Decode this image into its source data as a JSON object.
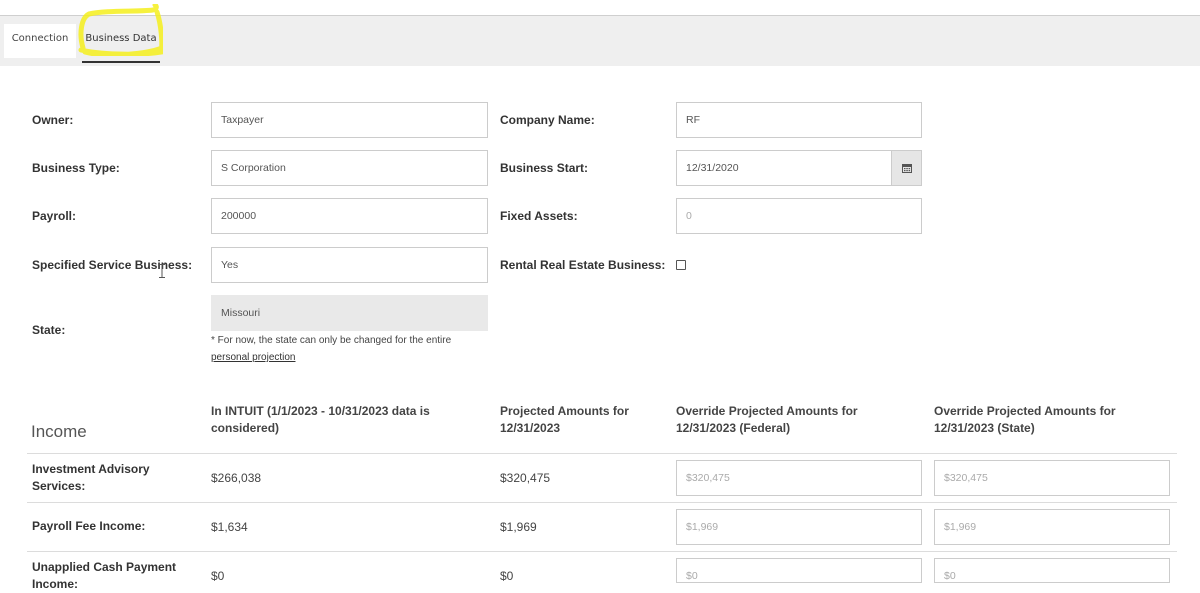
{
  "tabs": [
    {
      "label": "Connection"
    },
    {
      "label": "Business Data"
    }
  ],
  "form": {
    "owner": {
      "label": "Owner:",
      "value": "Taxpayer"
    },
    "company_name": {
      "label": "Company Name:",
      "value": "RF"
    },
    "business_type": {
      "label": "Business Type:",
      "value": "S Corporation"
    },
    "business_start": {
      "label": "Business Start:",
      "value": "12/31/2020"
    },
    "payroll": {
      "label": "Payroll:",
      "value": "200000"
    },
    "fixed_assets": {
      "label": "Fixed Assets:",
      "value": "0"
    },
    "specified_service": {
      "label": "Specified Service Business:",
      "value": "Yes"
    },
    "rental_real_estate": {
      "label": "Rental Real Estate Business:",
      "checked": false
    },
    "state": {
      "label": "State:",
      "value": "Missouri",
      "note": "* For now, the state can only be changed for the entire",
      "link": "personal projection"
    }
  },
  "income": {
    "title": "Income",
    "columns": [
      "In INTUIT (1/1/2023 - 10/31/2023 data is considered)",
      "Projected Amounts for 12/31/2023",
      "Override Projected Amounts for 12/31/2023 (Federal)",
      "Override Projected Amounts for 12/31/2023 (State)"
    ],
    "rows": [
      {
        "label": "Investment Advisory Services:",
        "intuit": "$266,038",
        "projected": "$320,475",
        "federal_placeholder": "$320,475",
        "state_placeholder": "$320,475"
      },
      {
        "label": "Payroll Fee Income:",
        "intuit": "$1,634",
        "projected": "$1,969",
        "federal_placeholder": "$1,969",
        "state_placeholder": "$1,969"
      },
      {
        "label": "Unapplied Cash Payment Income:",
        "intuit": "$0",
        "projected": "$0",
        "federal_placeholder": "$0",
        "state_placeholder": "$0"
      }
    ]
  },
  "colors": {
    "highlight": "#f5ee1c",
    "tab_bg": "#efefef",
    "disabled_field": "#e9e9e9"
  }
}
